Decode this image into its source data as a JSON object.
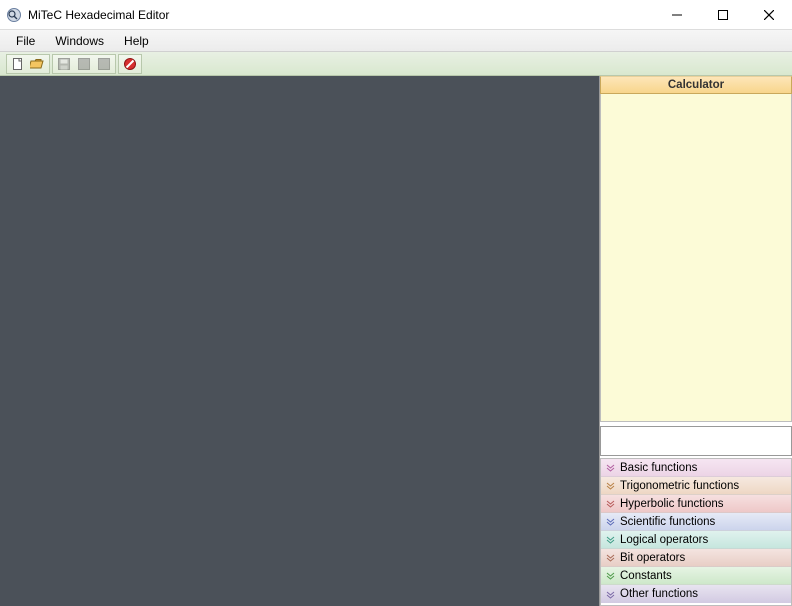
{
  "window": {
    "title": "MiTeC Hexadecimal Editor"
  },
  "menu": {
    "file": "File",
    "windows": "Windows",
    "help": "Help"
  },
  "side": {
    "calc_title": "Calculator"
  },
  "funcs": {
    "items": [
      "Basic functions",
      "Trigonometric functions",
      "Hyperbolic functions",
      "Scientific functions",
      "Logical operators",
      "Bit operators",
      "Constants",
      "Other functions"
    ]
  }
}
